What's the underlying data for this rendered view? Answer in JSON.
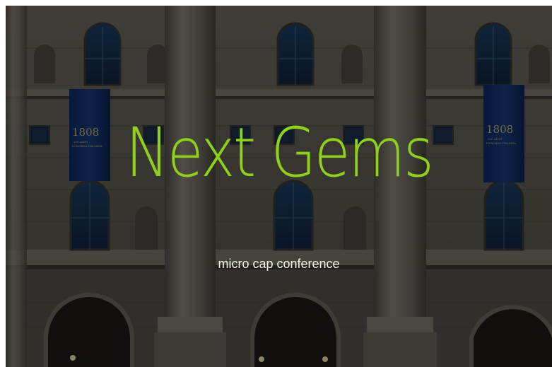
{
  "hero": {
    "title": "Next Gems",
    "subtitle": "micro cap conference",
    "title_color": "#8fd11a",
    "subtitle_color": "#f2f2f2",
    "background_image": "building-facade-image"
  }
}
